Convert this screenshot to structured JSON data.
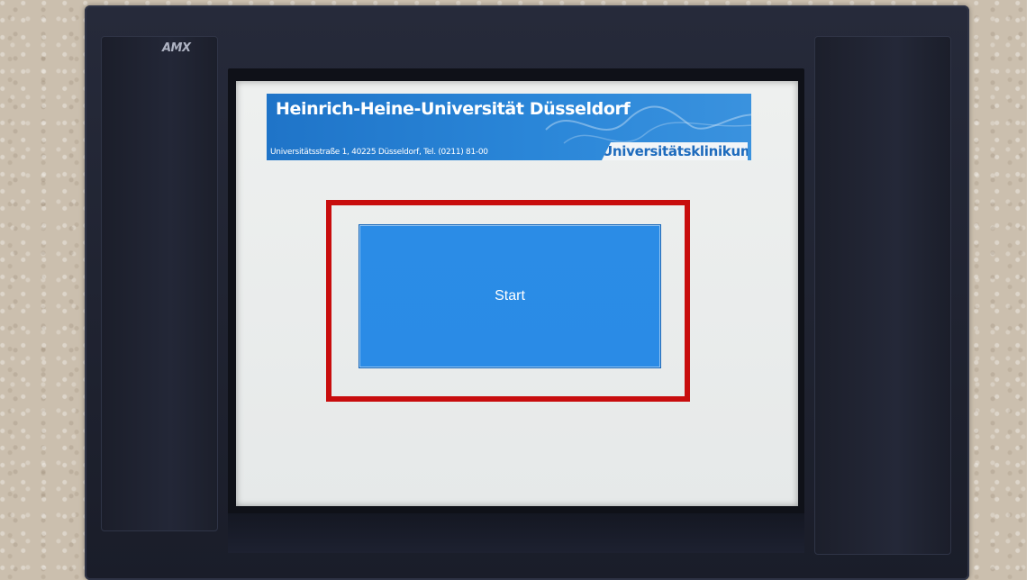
{
  "device": {
    "brand_logo": "AMX"
  },
  "banner": {
    "title": "Heinrich-Heine-Universität Düsseldorf",
    "address": "Universitätsstraße 1, 40225 Düsseldorf, Tel. (0211) 81-00",
    "tag": "Universitätsklinikum"
  },
  "main": {
    "start_label": "Start"
  },
  "colors": {
    "button_blue": "#2a8be6",
    "banner_blue": "#1f74c8",
    "highlight_red": "#c80d0d",
    "screen_bg": "#eceeed"
  }
}
